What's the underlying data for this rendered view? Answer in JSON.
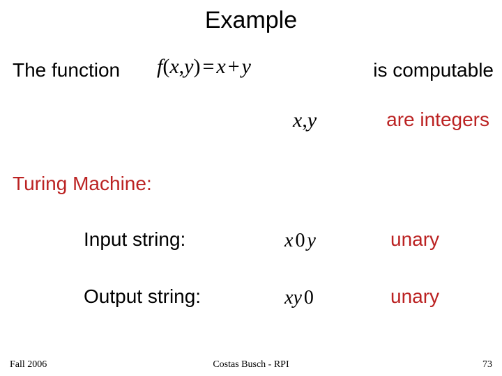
{
  "title": "Example",
  "line1": {
    "the_function": "The function",
    "formula_f": "f",
    "formula_lp": "(",
    "formula_x": "x",
    "formula_comma": ",",
    "formula_y": "y",
    "formula_rp": ")",
    "formula_eq": "=",
    "formula_x2": "x",
    "formula_plus": "+",
    "formula_y2": "y",
    "is_computable": "is computable"
  },
  "line2": {
    "x": "x",
    "comma": ",",
    "y": "y",
    "are_integers": "are integers"
  },
  "tm_heading": "Turing Machine:",
  "rows": {
    "input": {
      "label": "Input string:",
      "expr_x": "x",
      "expr_zero": "0",
      "expr_y": "y",
      "unary": "unary"
    },
    "output": {
      "label": "Output string:",
      "expr_x": "x",
      "expr_y": "y",
      "expr_zero": "0",
      "unary": "unary"
    }
  },
  "footer": {
    "left": "Fall 2006",
    "center": "Costas Busch - RPI",
    "right": "73"
  }
}
